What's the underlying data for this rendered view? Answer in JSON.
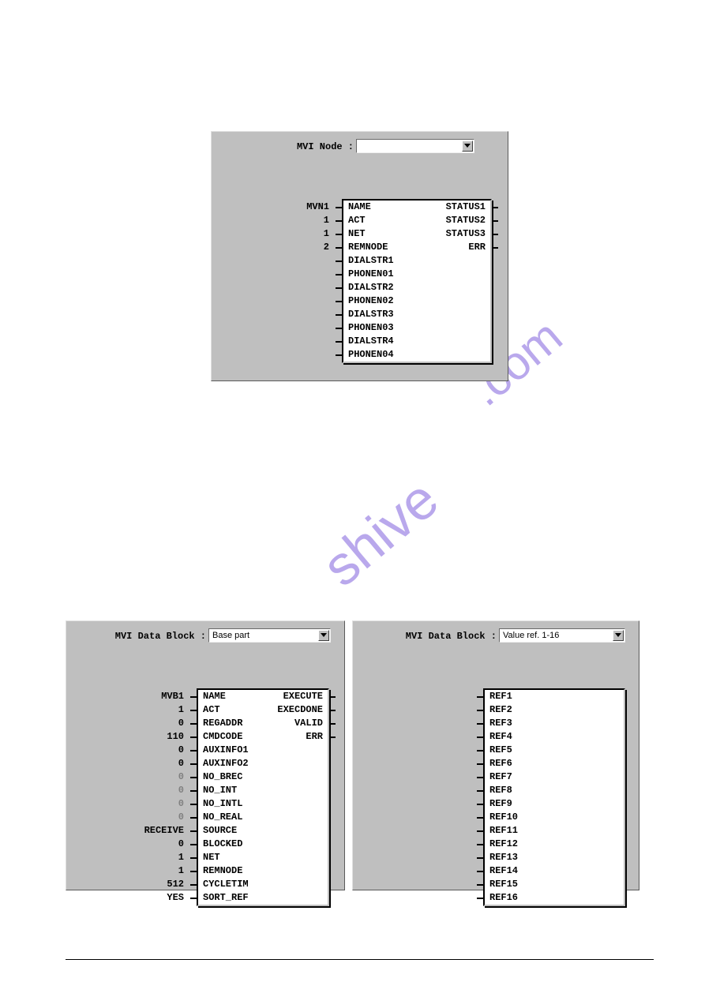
{
  "top": {
    "label": "MVI Node :",
    "dropdown_value": "",
    "left_values": [
      "MVN1",
      "1",
      "1",
      "2"
    ],
    "left_ports": [
      "NAME",
      "ACT",
      "NET",
      "REMNODE",
      "DIALSTR1",
      "PHONEN01",
      "DIALSTR2",
      "PHONEN02",
      "DIALSTR3",
      "PHONEN03",
      "DIALSTR4",
      "PHONEN04"
    ],
    "right_ports": [
      "STATUS1",
      "STATUS2",
      "STATUS3",
      "ERR"
    ]
  },
  "left": {
    "label": "MVI Data Block :",
    "dropdown_value": "Base part",
    "left_values": [
      "MVB1",
      "1",
      "0",
      "110",
      "0",
      "0",
      "0",
      "0",
      "0",
      "0",
      "RECEIVE",
      "0",
      "1",
      "1",
      "512",
      "YES"
    ],
    "left_gray": [
      false,
      false,
      false,
      false,
      false,
      false,
      true,
      true,
      true,
      true,
      false,
      false,
      false,
      false,
      false,
      false
    ],
    "left_ports": [
      "NAME",
      "ACT",
      "REGADDR",
      "CMDCODE",
      "AUXINFO1",
      "AUXINFO2",
      "NO_BREC",
      "NO_INT",
      "NO_INTL",
      "NO_REAL",
      "SOURCE",
      "BLOCKED",
      "NET",
      "REMNODE",
      "CYCLETIM",
      "SORT_REF"
    ],
    "right_ports": [
      "EXECUTE",
      "EXECDONE",
      "VALID",
      "ERR"
    ]
  },
  "right": {
    "label": "MVI Data Block :",
    "dropdown_value": "Value ref. 1-16",
    "left_ports": [
      "REF1",
      "REF2",
      "REF3",
      "REF4",
      "REF5",
      "REF6",
      "REF7",
      "REF8",
      "REF9",
      "REF10",
      "REF11",
      "REF12",
      "REF13",
      "REF14",
      "REF15",
      "REF16"
    ]
  },
  "watermark": "shive.com"
}
